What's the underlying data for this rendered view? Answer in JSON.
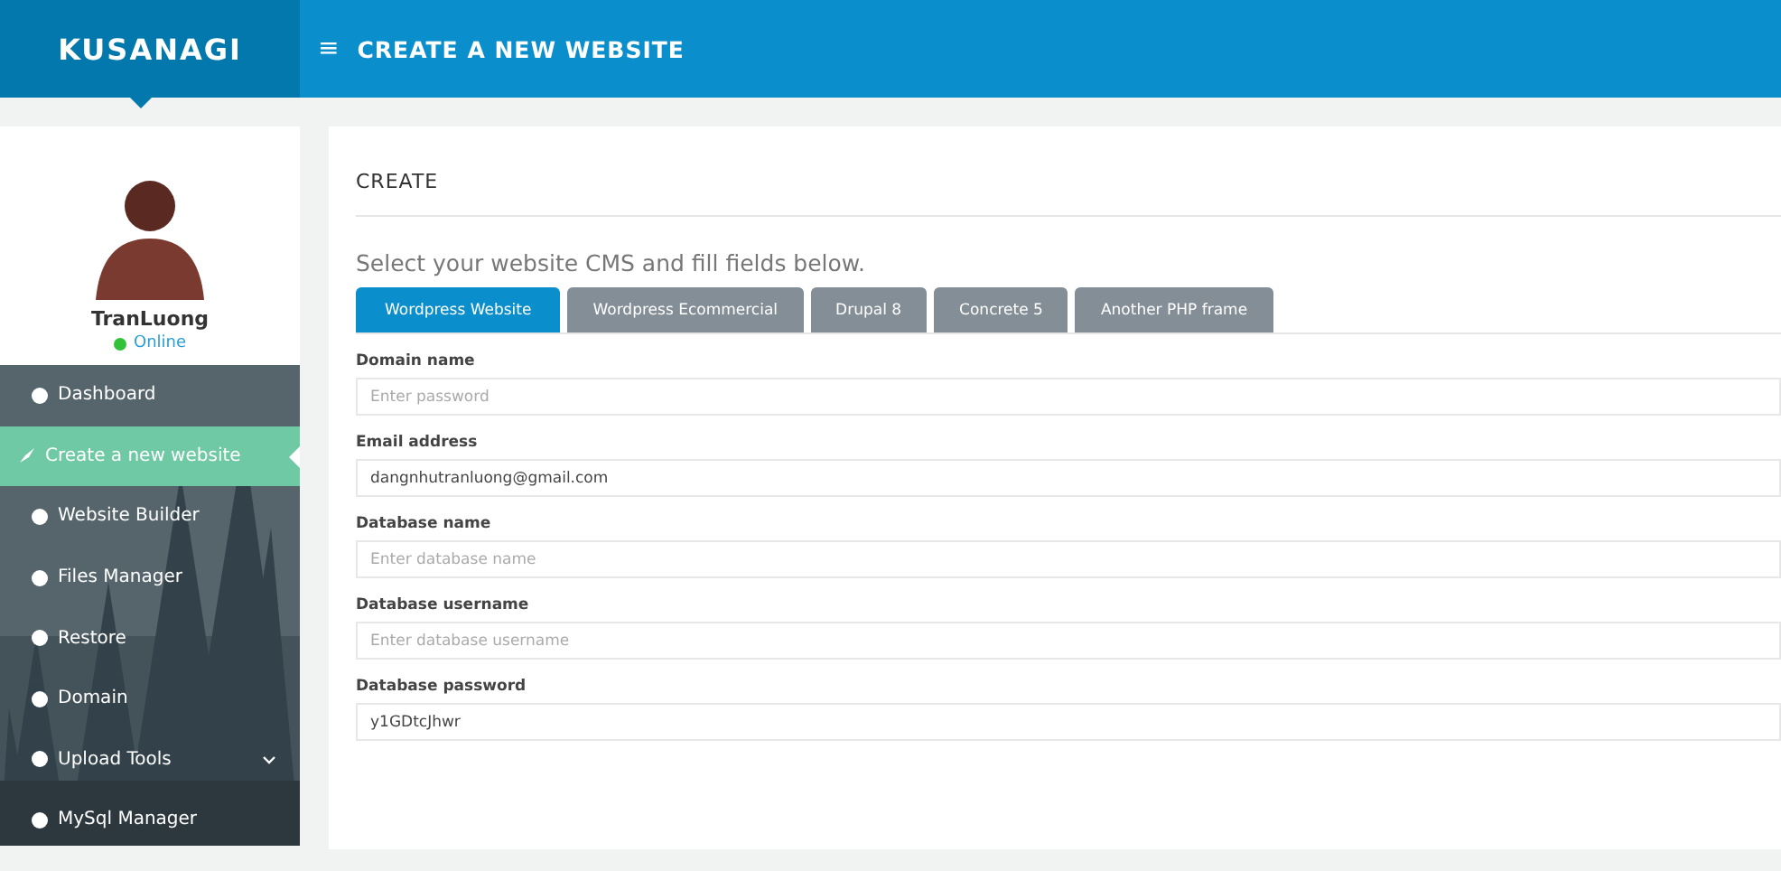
{
  "brand": "KUSANAGI",
  "header": {
    "menu_icon": "≡",
    "title": "CREATE A NEW WEBSITE"
  },
  "profile": {
    "name": "TranLuong",
    "status": "Online",
    "online": true
  },
  "sidebar": {
    "items": [
      {
        "label": "Dashboard",
        "selected": false,
        "expandable": false
      },
      {
        "label": "Create a new website",
        "selected": true,
        "expandable": false
      },
      {
        "label": "Website Builder",
        "selected": false,
        "expandable": false
      },
      {
        "label": "Files Manager",
        "selected": false,
        "expandable": false
      },
      {
        "label": "Restore",
        "selected": false,
        "expandable": false
      },
      {
        "label": "Domain",
        "selected": false,
        "expandable": false
      },
      {
        "label": "Upload Tools",
        "selected": false,
        "expandable": true
      },
      {
        "label": "MySql Manager",
        "selected": false,
        "expandable": false
      }
    ]
  },
  "card": {
    "title": "CREATE",
    "intro": "Select your website CMS and fill fields below.",
    "tabs": [
      {
        "label": "Wordpress Website",
        "selected": true
      },
      {
        "label": "Wordpress Ecommercial",
        "selected": false
      },
      {
        "label": "Drupal 8",
        "selected": false
      },
      {
        "label": "Concrete 5",
        "selected": false
      },
      {
        "label": "Another PHP frame",
        "selected": false
      }
    ],
    "fields": [
      {
        "label": "Domain name",
        "placeholder": "Enter password"
      },
      {
        "label": "Email address",
        "value": "dangnhutranluong@gmail.com"
      },
      {
        "label": "Database name",
        "placeholder": "Enter database name"
      },
      {
        "label": "Database username",
        "placeholder": "Enter database username"
      },
      {
        "label": "Database password",
        "value": "y1GDtcJhwr"
      }
    ]
  }
}
